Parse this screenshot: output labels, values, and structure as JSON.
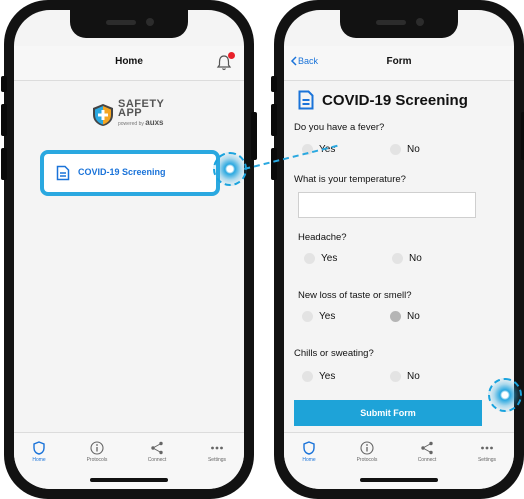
{
  "home_screen": {
    "title": "Home",
    "logo": {
      "line1": "SAFETY",
      "line2": "APP",
      "powered_by": "powered by",
      "brand": "auxs"
    },
    "menu_item_label": "COVID-19 Screening"
  },
  "form_screen": {
    "back_label": "Back",
    "title": "Form",
    "form_heading": "COVID-19 Screening",
    "questions": [
      {
        "label": "Do you have a fever?",
        "yes": "Yes",
        "no": "No",
        "selected": "none"
      },
      {
        "label": "What is your temperature?",
        "input_value": ""
      },
      {
        "label": "Headache?",
        "yes": "Yes",
        "no": "No",
        "selected": "none"
      },
      {
        "label": "New loss of taste or smell?",
        "yes": "Yes",
        "no": "No",
        "selected": "no"
      },
      {
        "label": "Chills or sweating?",
        "yes": "Yes",
        "no": "No",
        "selected": "none"
      }
    ],
    "submit_label": "Submit Form"
  },
  "tabs": [
    {
      "label": "Home",
      "icon": "shield-icon"
    },
    {
      "label": "Protocols",
      "icon": "info-icon"
    },
    {
      "label": "Connect",
      "icon": "share-icon"
    },
    {
      "label": "Settings",
      "icon": "more-icon"
    }
  ],
  "colors": {
    "accent": "#1a73d9",
    "highlight": "#2aa8e0",
    "submit": "#1ea3d8",
    "notification": "#e8202a"
  }
}
